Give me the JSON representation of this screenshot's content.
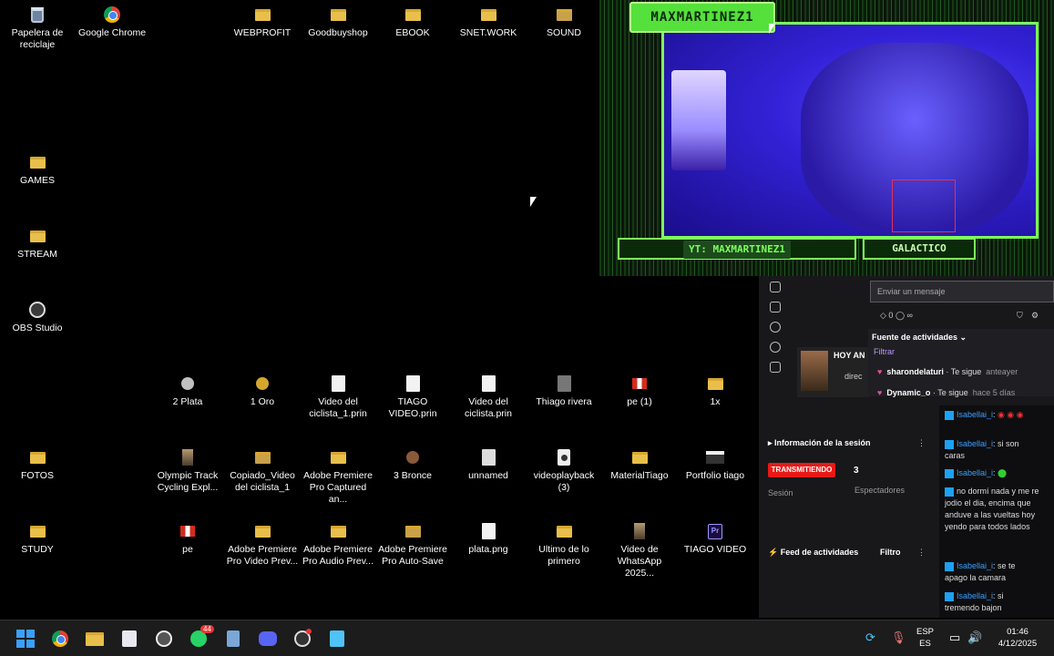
{
  "desktop": {
    "row1": [
      "Papelera de reciclaje",
      "Google Chrome",
      "WEBPROFIT",
      "Goodbuyshop",
      "EBOOK",
      "SNET.WORK",
      "SOUND"
    ],
    "left": [
      "GAMES",
      "STREAM",
      "OBS Studio",
      "FOTOS",
      "STUDY"
    ],
    "row2": [
      "2 Plata",
      "1 Oro",
      "Video del ciclista_1.prin",
      "TIAGO VIDEO.prin",
      "Video del ciclista.prin",
      "Thiago rivera",
      "pe (1)",
      "1x"
    ],
    "row3": [
      "Olympic Track Cycling Expl...",
      "Copiado_Video del ciclista_1",
      "Adobe Premiere Pro Captured an...",
      "3 Bronce",
      "unnamed",
      "videoplayback (3)",
      "MaterialTiago",
      "Portfolio tiago"
    ],
    "row4": [
      "pe",
      "Adobe Premiere Pro Video Prev...",
      "Adobe Premiere Pro Audio Prev...",
      "Adobe Premiere Pro Auto-Save",
      "plata.png",
      "Ultimo de lo primero",
      "Video de WhatsApp 2025...",
      "TIAGO VIDEO"
    ],
    "premiere_badge": "Pr"
  },
  "overlay": {
    "name": "MAXMARTINEZ1",
    "yt": "YT: MAXMARTINEZ1",
    "galactico": "GALACTICO"
  },
  "obs": {
    "message_placeholder": "Enviar un mensaje",
    "points": "0",
    "activity_header": "Fuente de actividades",
    "filter": "Filtrar",
    "feed": [
      {
        "user": "sharondelaturi",
        "action": "Te sigue",
        "time": "anteayer"
      },
      {
        "user": "Dynamic_o",
        "action": "Te sigue",
        "time": "hace 5 días"
      }
    ],
    "clip_title": "HOY AN",
    "clip_sub": "direc",
    "session_header": "Información de la sesión",
    "live_badge": "TRANSMITIENDO",
    "viewers": "3",
    "session_label": "Sesión",
    "viewers_label": "Espectadores",
    "activity_feed": "Feed de actividades",
    "filtro": "Filtro"
  },
  "chat": [
    {
      "user": "Isabellai_i",
      "text": ""
    },
    {
      "user": "Isabellai_i",
      "text": "si son caras"
    },
    {
      "user": "Isabellai_i",
      "text": ""
    },
    {
      "user": "",
      "text": "no dormí nada y me re jodio el dia, encima que anduve a las vueltas hoy yendo para todos lados"
    },
    {
      "user": "Isabellai_i",
      "text": "se te apago la camara"
    },
    {
      "user": "Isabellai_i",
      "text": "si tremendo bajon"
    }
  ],
  "taskbar": {
    "whatsapp_badge": "44",
    "lang": "ESP",
    "lang2": "ES",
    "time": "01:46",
    "date": "4/12/2025"
  }
}
